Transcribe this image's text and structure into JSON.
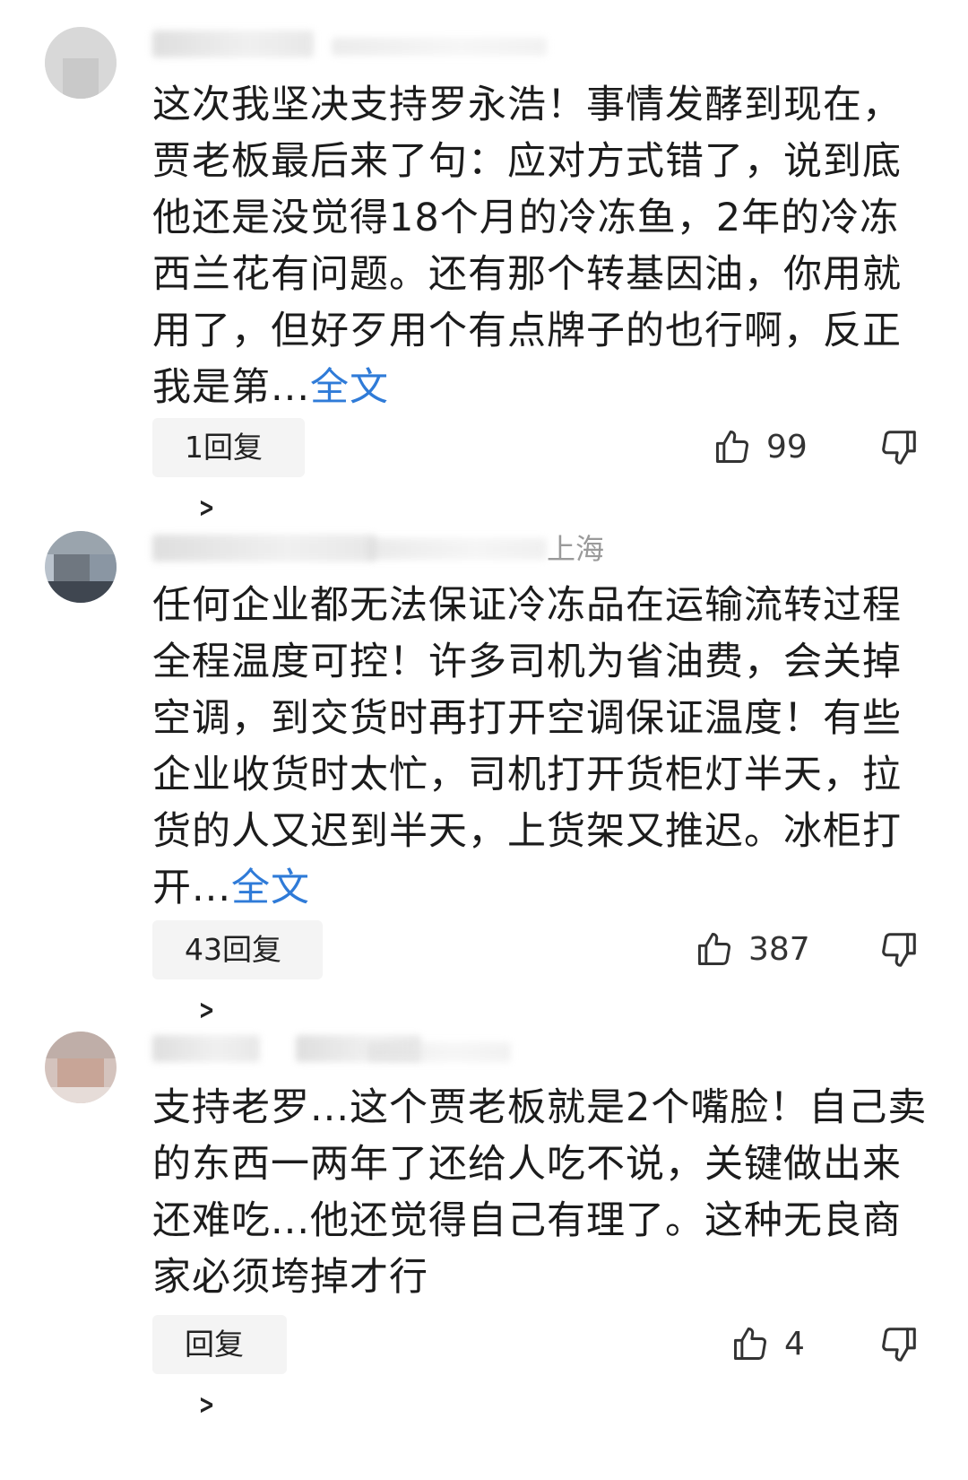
{
  "comments": [
    {
      "location": "",
      "text": "这次我坚决支持罗永浩！事情发酵到现在，贾老板最后来了句：应对方式错了，说到底他还是没觉得18个月的冷冻鱼，2年的冷冻西兰花有问题。还有那个转基因油，你用就用了，但好歹用个有点牌子的也行啊，反正我是第...",
      "more_label": "全文",
      "reply_label": "1回复",
      "likes": "99"
    },
    {
      "location": "上海",
      "text": "任何企业都无法保证冷冻品在运输流转过程全程温度可控！许多司机为省油费，会关掉空调，到交货时再打开空调保证温度！有些企业收货时太忙，司机打开货柜灯半天，拉货的人又迟到半天，上货架又推迟。冰柜打开...",
      "more_label": "全文",
      "reply_label": "43回复",
      "likes": "387"
    },
    {
      "location": "",
      "text": "支持老罗...这个贾老板就是2个嘴脸！自己卖的东西一两年了还给人吃不说，关键做出来还难吃...他还觉得自己有理了。这种无良商家必须垮掉才行",
      "more_label": "",
      "reply_label": "回复",
      "likes": "4"
    }
  ],
  "icons": {
    "like": "thumbs-up-icon",
    "dislike": "thumbs-down-icon",
    "reply_arrow": "chevron-right-icon"
  },
  "colors": {
    "link": "#2f7bd8",
    "reply_bg": "#f4f4f4"
  }
}
